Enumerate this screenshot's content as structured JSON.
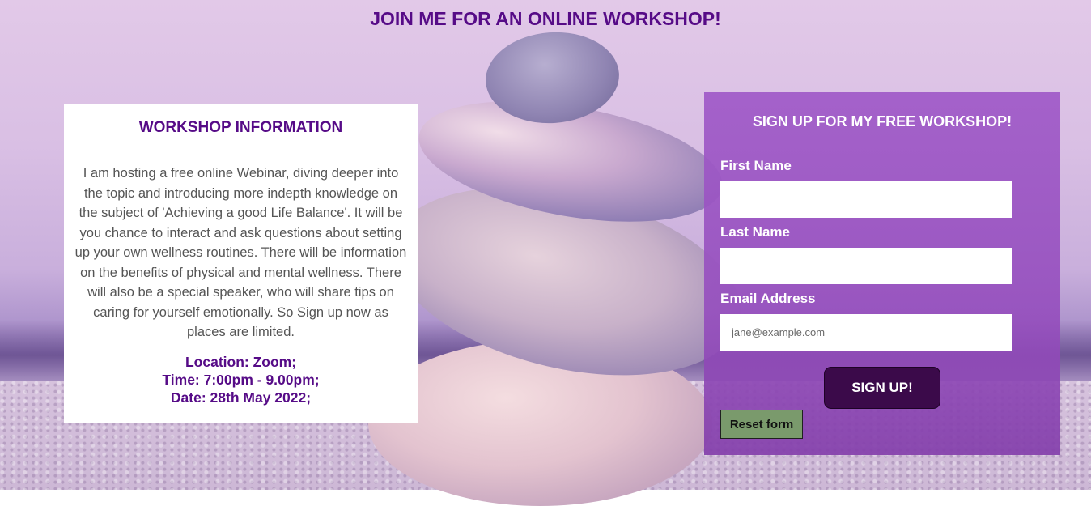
{
  "header": {
    "title": "JOIN ME FOR AN ONLINE WORKSHOP!"
  },
  "workshop_info": {
    "heading": "WORKSHOP INFORMATION",
    "description": "I am hosting a free online Webinar, diving deeper into the topic and introducing more indepth knowledge on the subject of 'Achieving a good Life Balance'. It will be you chance to interact and ask questions about setting up your own wellness routines. There will be information on the benefits of physical and mental wellness. There will also be a special speaker, who will share tips on caring for yourself emotionally. So Sign up now as places are limited.",
    "location": "Location: Zoom;",
    "time": "Time: 7:00pm - 9.00pm;",
    "date": "Date: 28th May 2022;"
  },
  "signup_form": {
    "heading": "SIGN UP FOR MY FREE WORKSHOP!",
    "first_name_label": "First Name",
    "first_name_value": "",
    "last_name_label": "Last Name",
    "last_name_value": "",
    "email_label": "Email Address",
    "email_value": "",
    "email_placeholder": "jane@example.com",
    "submit_label": "SIGN UP!",
    "reset_label": "Reset form"
  },
  "colors": {
    "title_purple": "#560b87",
    "form_panel": "#a05ac8",
    "submit_button": "#3b0a4a",
    "reset_button": "#7a9a6c"
  },
  "background": {
    "image_subject": "stacked-stones-photo"
  }
}
